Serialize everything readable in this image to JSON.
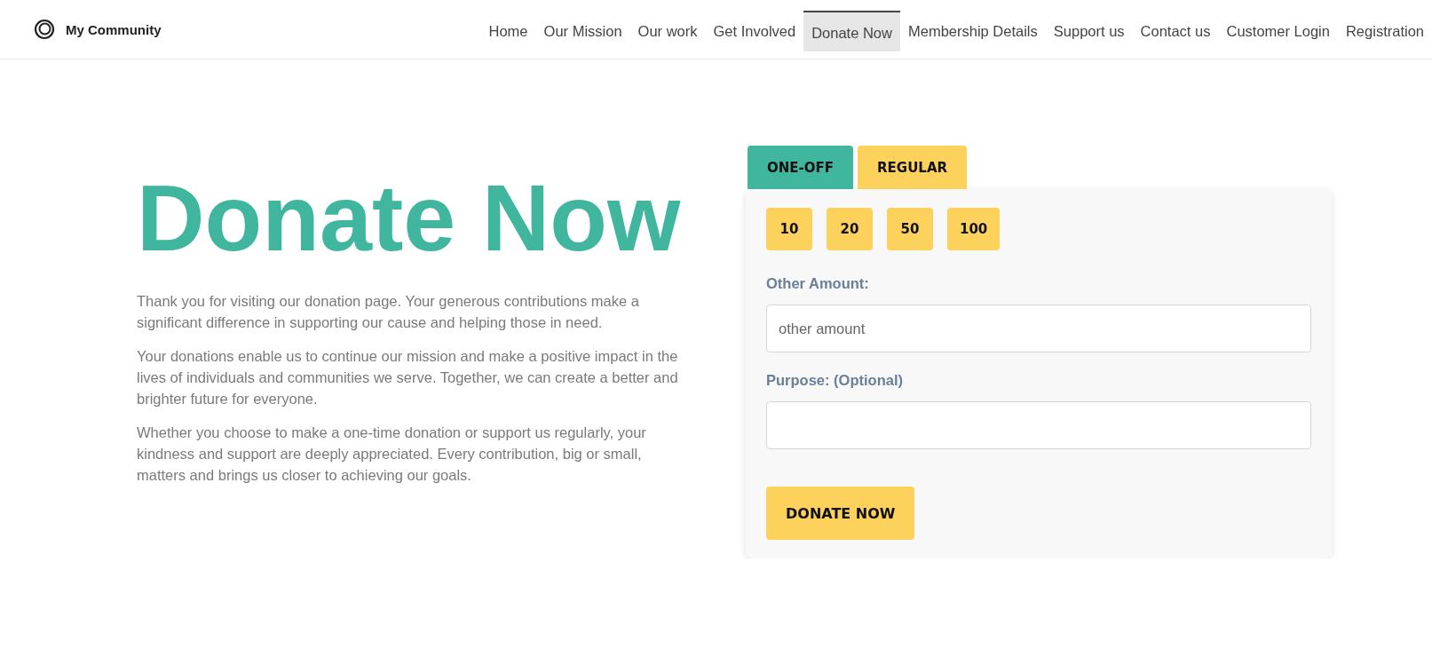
{
  "brand": {
    "name": "My Community"
  },
  "nav": [
    {
      "label": "Home",
      "selected": false
    },
    {
      "label": "Our Mission",
      "selected": false
    },
    {
      "label": "Our work",
      "selected": false
    },
    {
      "label": "Get Involved",
      "selected": false
    },
    {
      "label": "Donate Now",
      "selected": true
    },
    {
      "label": "Membership Details",
      "selected": false
    },
    {
      "label": "Support us",
      "selected": false
    },
    {
      "label": "Contact us",
      "selected": false
    },
    {
      "label": "Customer Login",
      "selected": false
    },
    {
      "label": "Registration",
      "selected": false
    }
  ],
  "heading": "Donate Now",
  "paragraphs": [
    "Thank you for visiting our donation page. Your generous contributions make a significant difference in supporting our cause and helping those in need.",
    "Your donations enable us to continue our mission and make a positive impact in the lives of individuals and communities we serve. Together, we can create a better and brighter future for everyone.",
    "Whether you choose to make a one-time donation or support us regularly, your kindness and support are deeply appreciated. Every contribution, big or small, matters and brings us closer to achieving our goals."
  ],
  "donation_tabs": [
    {
      "label": "ONE-OFF",
      "selected": true
    },
    {
      "label": "REGULAR",
      "selected": false
    }
  ],
  "amounts": [
    "10",
    "20",
    "50",
    "100"
  ],
  "other_amount": {
    "label": "Other Amount:",
    "placeholder": "other amount"
  },
  "purpose": {
    "label": "Purpose: (Optional)"
  },
  "submit": "DONATE NOW"
}
